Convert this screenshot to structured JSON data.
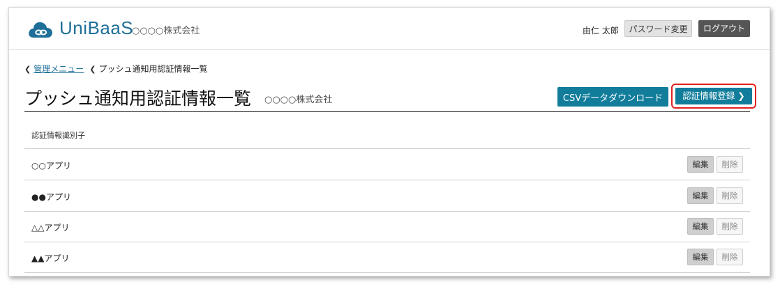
{
  "header": {
    "brand": "UniBaaS",
    "company": "○○○○株式会社",
    "user_name": "由仁 太郎",
    "password_button": "パスワード変更",
    "logout_button": "ログアウト"
  },
  "breadcrumb": {
    "items": [
      {
        "label": "管理メニュー"
      },
      {
        "label": "プッシュ通知用認証情報一覧"
      }
    ]
  },
  "page": {
    "title": "プッシュ通知用認証情報一覧",
    "company": "○○○○株式会社",
    "csv_button": "CSVデータダウンロード",
    "register_button": "認証情報登録 ❯"
  },
  "table": {
    "column_header": "認証情報識別子",
    "rows": [
      {
        "name": "○○アプリ",
        "edit": "編集",
        "delete": "削除"
      },
      {
        "name": "●●アプリ",
        "edit": "編集",
        "delete": "削除"
      },
      {
        "name": "△△アプリ",
        "edit": "編集",
        "delete": "削除"
      },
      {
        "name": "▲▲アプリ",
        "edit": "編集",
        "delete": "削除"
      }
    ]
  },
  "colors": {
    "brand": "#1f6f99",
    "primary_button": "#117d9b",
    "highlight": "#e02020"
  }
}
